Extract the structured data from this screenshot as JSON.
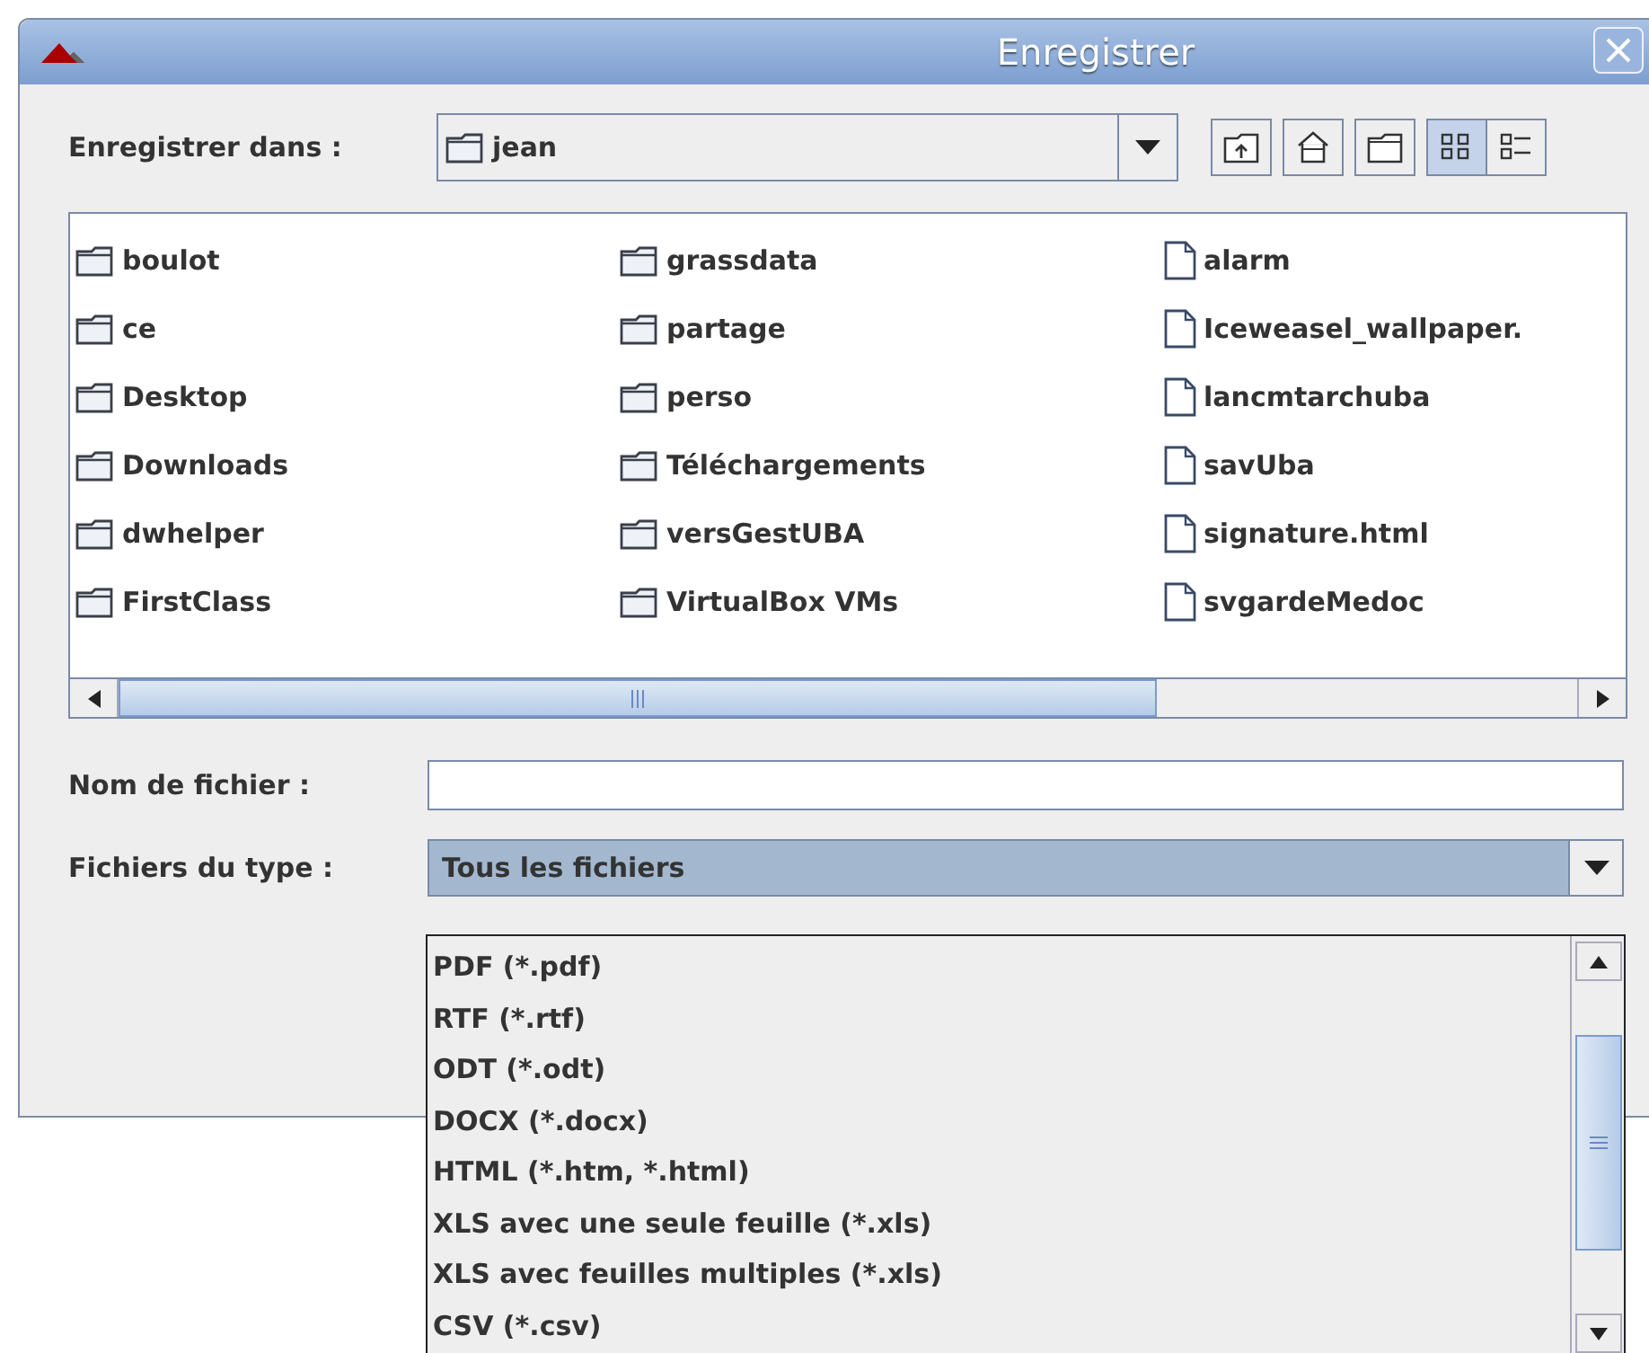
{
  "window": {
    "title": "Enregistrer"
  },
  "save_in": {
    "label": "Enregistrer dans :",
    "value": "jean"
  },
  "toolbar": [
    {
      "kind": "up",
      "selected": false
    },
    {
      "kind": "home",
      "selected": false
    },
    {
      "kind": "new-folder",
      "selected": false
    },
    {
      "kind": "list",
      "selected": true
    },
    {
      "kind": "details",
      "selected": false
    }
  ],
  "files": [
    {
      "name": "boulot",
      "kind": "folder"
    },
    {
      "name": "ce",
      "kind": "folder"
    },
    {
      "name": "Desktop",
      "kind": "folder"
    },
    {
      "name": "Downloads",
      "kind": "folder"
    },
    {
      "name": "dwhelper",
      "kind": "folder"
    },
    {
      "name": "FirstClass",
      "kind": "folder"
    },
    {
      "name": "grassdata",
      "kind": "folder"
    },
    {
      "name": "partage",
      "kind": "folder"
    },
    {
      "name": "perso",
      "kind": "folder"
    },
    {
      "name": "Téléchargements",
      "kind": "folder"
    },
    {
      "name": "versGestUBA",
      "kind": "folder"
    },
    {
      "name": "VirtualBox VMs",
      "kind": "folder"
    },
    {
      "name": "alarm",
      "kind": "file"
    },
    {
      "name": "Iceweasel_wallpaper.",
      "kind": "file"
    },
    {
      "name": "lancmtarchuba",
      "kind": "file"
    },
    {
      "name": "savUba",
      "kind": "file"
    },
    {
      "name": "signature.html",
      "kind": "file"
    },
    {
      "name": "svgardeMedoc",
      "kind": "file"
    }
  ],
  "file_name": {
    "label": "Nom de fichier :"
  },
  "file_type": {
    "label": "Fichiers du type :",
    "value": "Tous les fichiers",
    "expanded": true,
    "options": [
      {
        "label": "PDF (*.pdf)",
        "selected": false
      },
      {
        "label": "RTF (*.rtf)",
        "selected": false
      },
      {
        "label": "ODT (*.odt)",
        "selected": false
      },
      {
        "label": "DOCX (*.docx)",
        "selected": false
      },
      {
        "label": "HTML (*.htm, *.html)",
        "selected": false
      },
      {
        "label": "XLS avec une seule feuille (*.xls)",
        "selected": false
      },
      {
        "label": "XLS avec feuilles multiples (*.xls)",
        "selected": false
      },
      {
        "label": "CSV (*.csv)",
        "selected": false
      }
    ]
  }
}
